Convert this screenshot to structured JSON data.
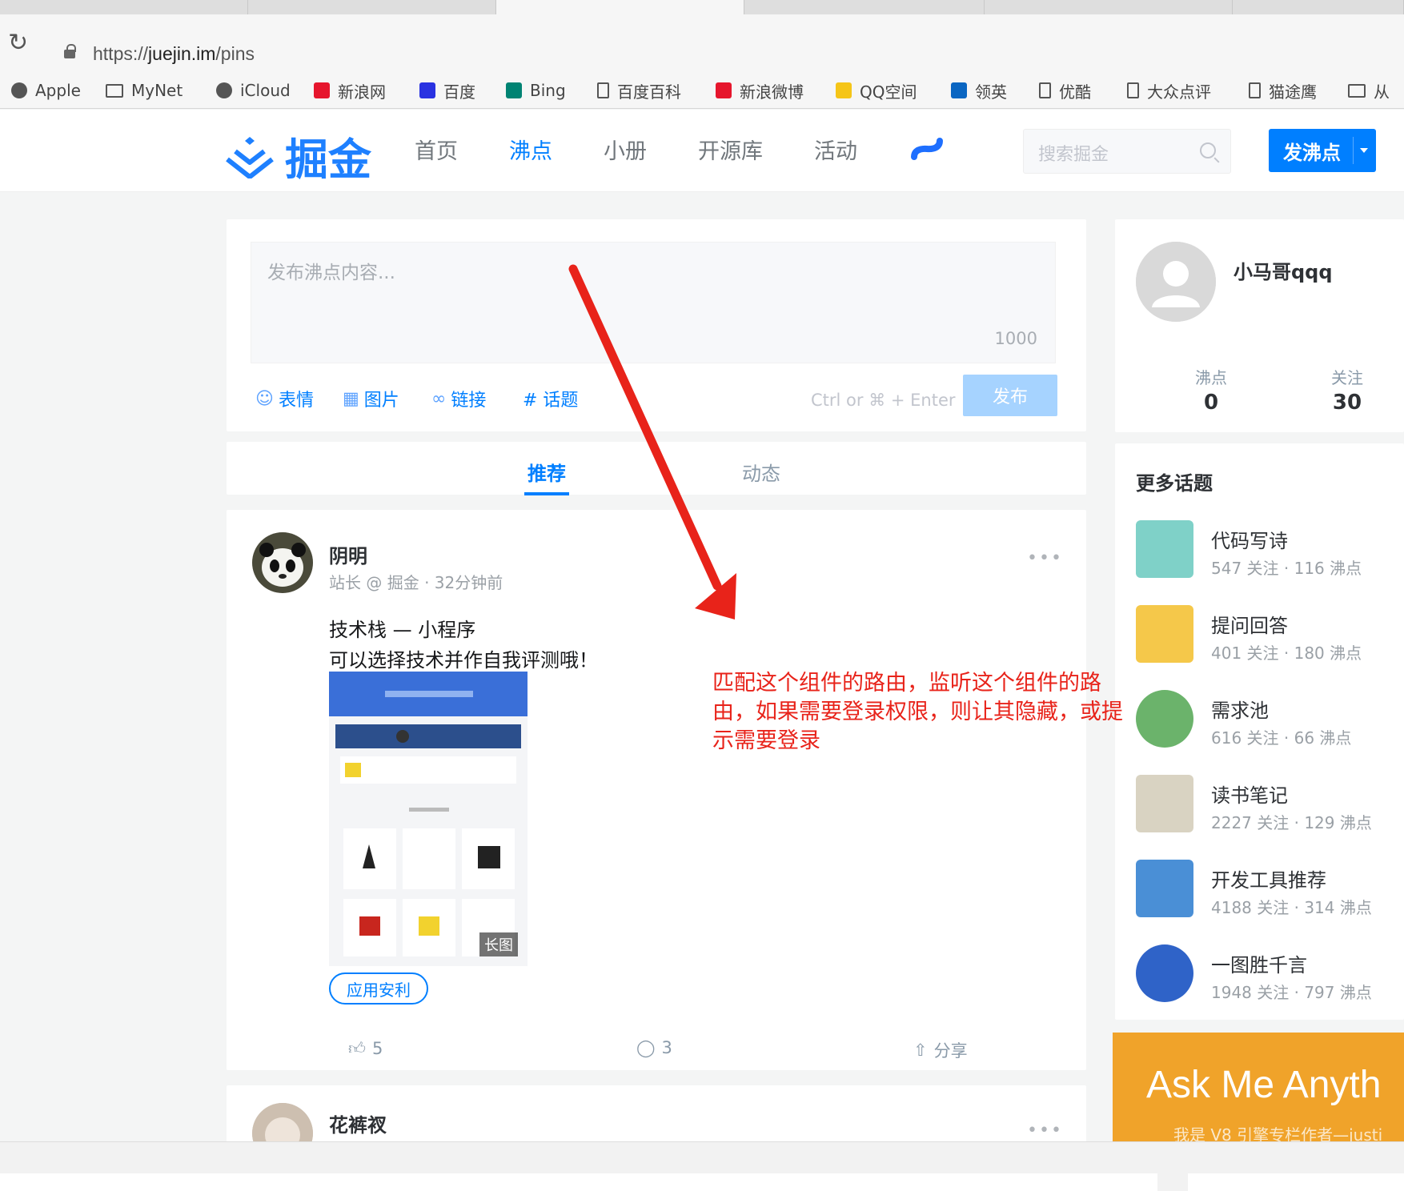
{
  "browser": {
    "url_prefix": "https://",
    "url_host": "juejin.im",
    "url_path": "/pins",
    "bookmarks": [
      {
        "label": "Apple",
        "icon": "apple-icon"
      },
      {
        "label": "MyNet",
        "icon": "folder-icon"
      },
      {
        "label": "iCloud",
        "icon": "apple-icon"
      },
      {
        "label": "新浪网",
        "icon": "sina-icon"
      },
      {
        "label": "百度",
        "icon": "baidu-icon"
      },
      {
        "label": "Bing",
        "icon": "bing-icon"
      },
      {
        "label": "百度百科",
        "icon": "doc-icon"
      },
      {
        "label": "新浪微博",
        "icon": "weibo-icon"
      },
      {
        "label": "QQ空间",
        "icon": "star-icon"
      },
      {
        "label": "领英",
        "icon": "linkedin-icon"
      },
      {
        "label": "优酷",
        "icon": "doc-icon"
      },
      {
        "label": "大众点评",
        "icon": "doc-icon"
      },
      {
        "label": "猫途鹰",
        "icon": "doc-icon"
      },
      {
        "label": "从",
        "icon": "folder-icon"
      }
    ]
  },
  "header": {
    "logo_text": "掘金",
    "nav": [
      "首页",
      "沸点",
      "小册",
      "开源库",
      "活动"
    ],
    "active_nav": "沸点",
    "search_placeholder": "搜索掘金",
    "publish_label": "发沸点"
  },
  "composer": {
    "placeholder": "发布沸点内容...",
    "char_limit": "1000",
    "tools": [
      "表情",
      "图片",
      "链接",
      "# 话题"
    ],
    "shortcut_hint": "Ctrl or ⌘ + Enter",
    "send_label": "发布"
  },
  "feed_tabs": {
    "recommend": "推荐",
    "activity": "动态"
  },
  "post": {
    "author": "阴明",
    "meta": "站长 @ 掘金 · 32分钟前",
    "line1": "技术栈 — 小程序",
    "line2": "可以选择技术并作自我评测哦！",
    "image_badge": "长图",
    "topic": "应用安利",
    "likes": "5",
    "comments": "3",
    "share": "分享"
  },
  "post2": {
    "author": "花裤衩"
  },
  "profile": {
    "name": "小马哥qqq",
    "pins_label": "沸点",
    "pins_value": "0",
    "following_label": "关注",
    "following_value": "30"
  },
  "topics": {
    "title": "更多话题",
    "items": [
      {
        "name": "代码写诗",
        "stats": "547 关注 · 116 沸点",
        "color": "#7fd1c8"
      },
      {
        "name": "提问回答",
        "stats": "401 关注 · 180 沸点",
        "color": "#f5c84a"
      },
      {
        "name": "需求池",
        "stats": "616 关注 · 66 沸点",
        "color": "#6bb36b"
      },
      {
        "name": "读书笔记",
        "stats": "2227 关注 · 129 沸点",
        "color": "#d9d3c2"
      },
      {
        "name": "开发工具推荐",
        "stats": "4188 关注 · 314 沸点",
        "color": "#4a8fd6"
      },
      {
        "name": "一图胜千言",
        "stats": "1948 关注 · 797 沸点",
        "color": "#2f63c8"
      }
    ]
  },
  "banner": {
    "title": "Ask Me Anyth",
    "subtitle": "我是 V8 引擎专栏作者—justi"
  },
  "annotation": {
    "text": "匹配这个组件的路由，监听这个组件的路由，如果需要登录权限，则让其隐藏，或提示需要登录"
  },
  "colors": {
    "brand": "#007fff",
    "annotation_red": "#e8231a"
  }
}
